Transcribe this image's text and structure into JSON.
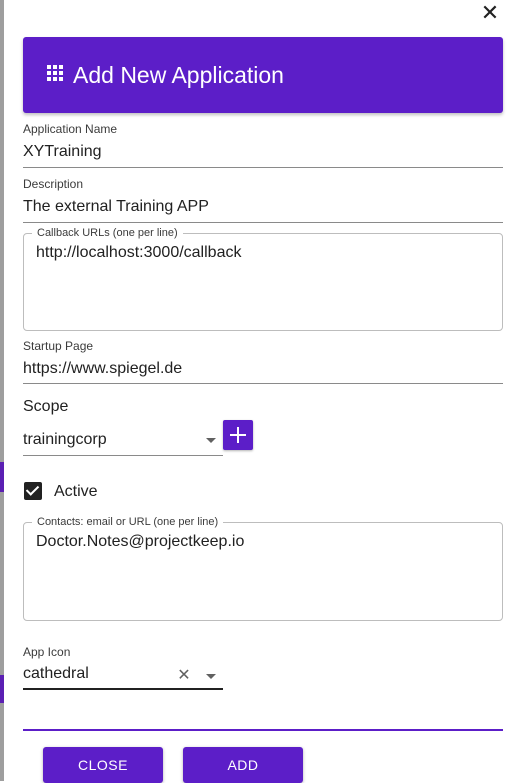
{
  "dialog": {
    "title": "Add New Application",
    "close_icon": "close-icon",
    "header_icon": "apps-grid-icon",
    "accent_color": "#5c1ec8"
  },
  "form": {
    "app_name": {
      "label": "Application Name",
      "value": "XYTraining"
    },
    "description": {
      "label": "Description",
      "value": "The external Training APP"
    },
    "callback_urls": {
      "label": "Callback URLs (one per line)",
      "value": "http://localhost:3000/callback"
    },
    "startup_page": {
      "label": "Startup Page",
      "value": "https://www.spiegel.de"
    },
    "scope": {
      "label": "Scope",
      "value": "trainingcorp",
      "add_icon": "plus-icon"
    },
    "active": {
      "label": "Active",
      "checked": true
    },
    "contacts": {
      "label": "Contacts: email or URL (one per line)",
      "value": "Doctor.Notes@projectkeep.io"
    },
    "app_icon": {
      "label": "App Icon",
      "value": "cathedral",
      "clear_icon": "clear-icon"
    }
  },
  "buttons": {
    "close_label": "CLOSE",
    "add_label": "ADD"
  }
}
